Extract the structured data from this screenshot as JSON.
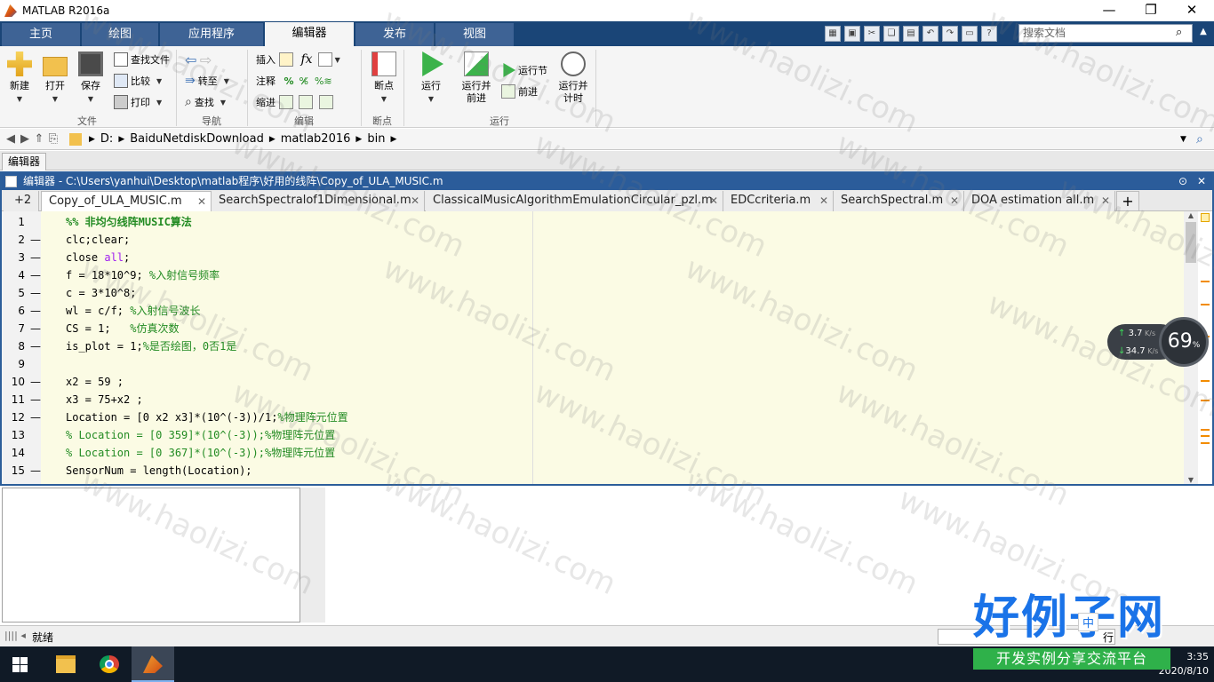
{
  "window": {
    "title": "MATLAB R2016a",
    "minimize": "—",
    "restore": "❐",
    "close": "✕"
  },
  "ribbon_tabs": [
    "主页",
    "绘图",
    "应用程序",
    "编辑器",
    "发布",
    "视图"
  ],
  "search_docs": {
    "placeholder": "搜索文档"
  },
  "ribbon": {
    "file": {
      "new": "新建",
      "open": "打开",
      "save": "保存",
      "find_files": "查找文件",
      "compare": "比较",
      "print": "打印",
      "group": "文件"
    },
    "navigate": {
      "goto": "转至",
      "find": "查找",
      "group": "导航"
    },
    "edit": {
      "insert": "插入",
      "comment": "注释",
      "indent": "缩进",
      "group": "编辑",
      "fx": "fx",
      "percent": "%"
    },
    "breakpoints": {
      "label": "断点",
      "group": "断点"
    },
    "run": {
      "run": "运行",
      "run_advance_1": "运行并",
      "run_advance_2": "前进",
      "run_section": "运行节",
      "advance": "前进",
      "run_time_1": "运行并",
      "run_time_2": "计时",
      "group": "运行"
    }
  },
  "address": {
    "segments": [
      "D:",
      "BaiduNetdiskDownload",
      "matlab2016",
      "bin"
    ]
  },
  "editor_tab_label": "编辑器",
  "editor": {
    "title": "编辑器 - C:\\Users\\yanhui\\Desktop\\matlab程序\\好用的线阵\\Copy_of_ULA_MUSIC.m",
    "tab_overflow": "+2",
    "file_tabs": [
      "Copy_of_ULA_MUSIC.m",
      "SearchSpectralof1Dimensional.m",
      "ClassicalMusicAlgorithmEmulationCircular_pzl.m",
      "EDCcriteria.m",
      "SearchSpectral.m",
      "DOA estimation all.m"
    ],
    "add_tab": "+",
    "lines": [
      {
        "n": "1",
        "dash": "",
        "parts": [
          {
            "t": "%% 非均匀线阵MUSIC算法",
            "c": "hd"
          }
        ]
      },
      {
        "n": "2",
        "dash": "—",
        "parts": [
          {
            "t": "clc;clear;",
            "c": ""
          }
        ]
      },
      {
        "n": "3",
        "dash": "—",
        "parts": [
          {
            "t": "close ",
            "c": ""
          },
          {
            "t": "all",
            "c": "kw"
          },
          {
            "t": ";",
            "c": ""
          }
        ]
      },
      {
        "n": "4",
        "dash": "—",
        "parts": [
          {
            "t": "f = 18*10^9; ",
            "c": ""
          },
          {
            "t": "%入射信号频率",
            "c": "cm"
          }
        ]
      },
      {
        "n": "5",
        "dash": "—",
        "parts": [
          {
            "t": "c = 3*10^8;",
            "c": ""
          }
        ]
      },
      {
        "n": "6",
        "dash": "—",
        "parts": [
          {
            "t": "wl = c/f; ",
            "c": ""
          },
          {
            "t": "%入射信号波长",
            "c": "cm"
          }
        ]
      },
      {
        "n": "7",
        "dash": "—",
        "parts": [
          {
            "t": "CS = 1;   ",
            "c": ""
          },
          {
            "t": "%仿真次数",
            "c": "cm"
          }
        ]
      },
      {
        "n": "8",
        "dash": "—",
        "parts": [
          {
            "t": "is_plot = 1;",
            "c": ""
          },
          {
            "t": "%是否绘图，0否1是",
            "c": "cm"
          }
        ]
      },
      {
        "n": "9",
        "dash": "",
        "parts": [
          {
            "t": "",
            "c": ""
          }
        ]
      },
      {
        "n": "10",
        "dash": "—",
        "parts": [
          {
            "t": "x2 = 59 ;",
            "c": ""
          }
        ]
      },
      {
        "n": "11",
        "dash": "—",
        "parts": [
          {
            "t": "x3 = 75+x2 ;",
            "c": ""
          }
        ]
      },
      {
        "n": "12",
        "dash": "—",
        "parts": [
          {
            "t": "Location = [0 x2 x3]*(10^(-3))/1;",
            "c": ""
          },
          {
            "t": "%物理阵元位置",
            "c": "cm"
          }
        ]
      },
      {
        "n": "13",
        "dash": "",
        "parts": [
          {
            "t": "% Location = [0 359]*(10^(-3));%物理阵元位置",
            "c": "cm"
          }
        ]
      },
      {
        "n": "14",
        "dash": "",
        "parts": [
          {
            "t": "% Location = [0 367]*(10^(-3));%物理阵元位置",
            "c": "cm"
          }
        ]
      },
      {
        "n": "15",
        "dash": "—",
        "parts": [
          {
            "t": "SensorNum = length(Location);",
            "c": ""
          }
        ]
      }
    ]
  },
  "network_widget": {
    "up": "3.7",
    "up_unit": "K/s",
    "down": "34.7",
    "down_unit": "K/s",
    "percent": "69",
    "percent_sign": "%"
  },
  "status": {
    "text": "就绪",
    "row_label": "行"
  },
  "watermark_site": "www.haolizi.com",
  "brand_watermark": {
    "title": "好例子网",
    "subtitle": "开发实例分享交流平台",
    "ime": "中"
  },
  "clock": {
    "time": "3:35",
    "date": "2020/8/10"
  },
  "colors": {
    "ribbon_tab_bg": "#1a4577",
    "editor_border": "#2c5e9a",
    "code_bg": "#fbfbe4",
    "comment": "#228b22",
    "keyword": "#a020f0"
  }
}
